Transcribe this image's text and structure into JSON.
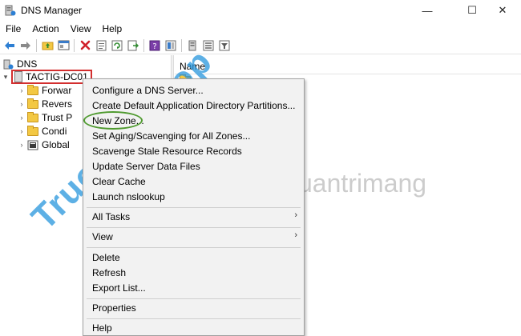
{
  "window": {
    "title": "DNS Manager",
    "controls": {
      "minimize": "—",
      "maximize": "☐",
      "close": "✕"
    }
  },
  "menubar": {
    "items": [
      "File",
      "Action",
      "View",
      "Help"
    ]
  },
  "toolbar": {
    "buttons": [
      "back-arrow-icon",
      "forward-arrow-icon",
      "up-folder-icon",
      "console-tree-icon",
      "delete-icon",
      "properties-icon",
      "refresh-icon",
      "export-list-icon",
      "help-icon",
      "help-topics-icon",
      "record-icon",
      "server-list-icon",
      "filter-icon"
    ]
  },
  "tree": {
    "root": "DNS",
    "server": "TACTIG-DC01",
    "children": [
      "Forwar",
      "Revers",
      "Trust P",
      "Condi",
      "Global"
    ]
  },
  "right_pane": {
    "column_name": "Name"
  },
  "context_menu": {
    "items": [
      {
        "label": "Configure a DNS Server..."
      },
      {
        "label": "Create Default Application Directory Partitions..."
      },
      {
        "label": "New Zone..."
      },
      {
        "label": "Set Aging/Scavenging for All Zones..."
      },
      {
        "label": "Scavenge Stale Resource Records"
      },
      {
        "label": "Update Server Data Files"
      },
      {
        "label": "Clear Cache"
      },
      {
        "label": "Launch nslookup"
      },
      {
        "label": "All Tasks"
      },
      {
        "label": "View"
      },
      {
        "label": "Delete"
      },
      {
        "label": "Refresh"
      },
      {
        "label": "Export List..."
      },
      {
        "label": "Properties"
      },
      {
        "label": "Help"
      }
    ]
  },
  "watermark": {
    "left": "Truongtin.top",
    "right": "uantrimang"
  },
  "colors": {
    "highlight_red": "#d32f2f",
    "circle_green": "#4f9a2f",
    "watermark_blue": "#2796dc"
  }
}
